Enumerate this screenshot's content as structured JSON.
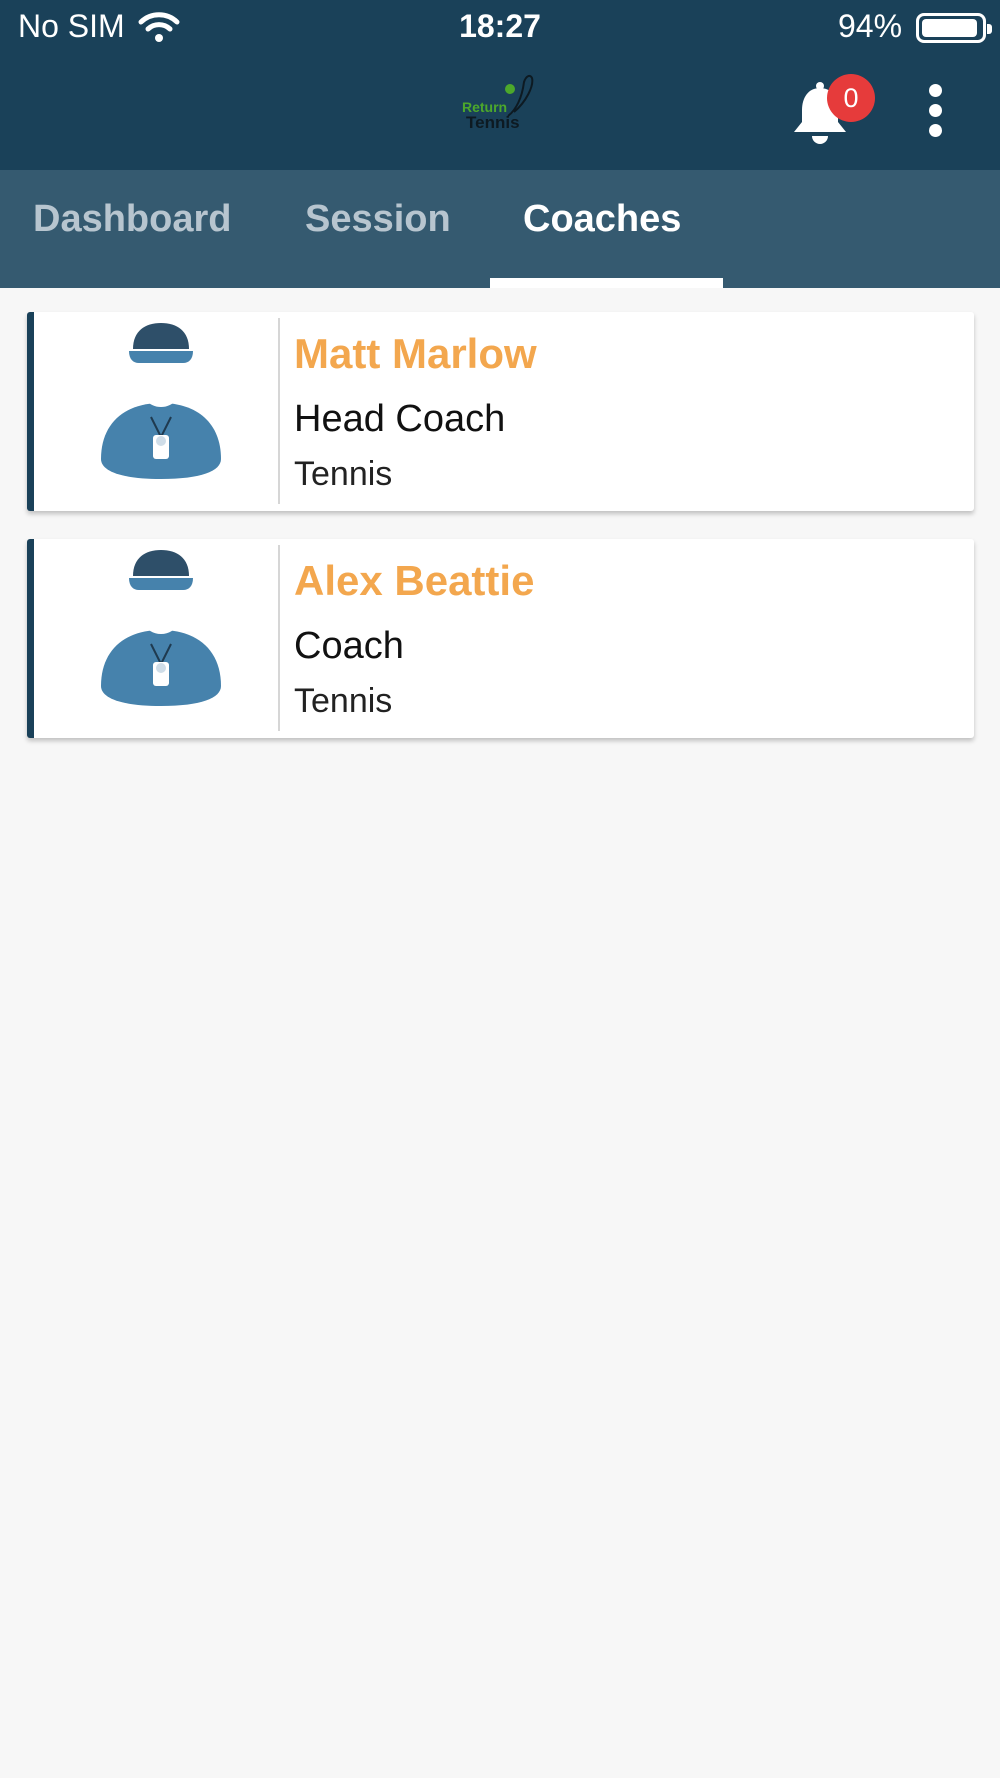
{
  "status_bar": {
    "carrier": "No SIM",
    "time": "18:27",
    "battery_percent": "94%",
    "battery_level": 0.94
  },
  "header": {
    "logo_text_top": "Return",
    "logo_text_bottom": "Tennis",
    "notification_count": "0",
    "icons": [
      "bell-icon",
      "more-vertical-icon"
    ]
  },
  "tabs": [
    {
      "label": "Dashboard",
      "active": false
    },
    {
      "label": "Session",
      "active": false
    },
    {
      "label": "Coaches",
      "active": true
    }
  ],
  "coaches": [
    {
      "name": "Matt Marlow",
      "role": "Head Coach",
      "sport": "Tennis"
    },
    {
      "name": "Alex Beattie",
      "role": "Coach",
      "sport": "Tennis"
    }
  ],
  "colors": {
    "header_bg": "#1a4159",
    "tabs_bg": "#355a70",
    "name_accent": "#f3a74e",
    "badge": "#e63b3b",
    "avatar_body": "#4682ac",
    "avatar_cap": "#2e4f69"
  }
}
